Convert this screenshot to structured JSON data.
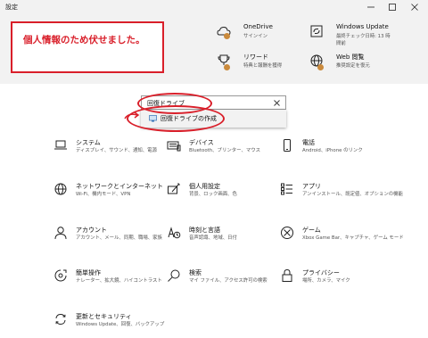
{
  "window": {
    "title": "設定"
  },
  "privacy_note": "個人情報のため伏せました。",
  "header": {
    "onedrive": {
      "title": "OneDrive",
      "subtitle": "サインイン"
    },
    "windows_update": {
      "title": "Windows Update",
      "subtitle_line1": "最終チェック日時: 13 時",
      "subtitle_line2": "間前"
    },
    "rewards": {
      "title": "リワード",
      "subtitle": "特典と報酬を獲得"
    },
    "web_browsing": {
      "title": "Web 閲覧",
      "subtitle": "推奨設定を復元"
    }
  },
  "search": {
    "value": "回復ドライブ"
  },
  "suggestion": {
    "label": "回復ドライブの作成"
  },
  "categories": [
    {
      "title": "システム",
      "subtitle": "ディスプレイ、サウンド、通知、電源",
      "icon": "laptop-icon"
    },
    {
      "title": "デバイス",
      "subtitle": "Bluetooth、プリンター、マウス",
      "icon": "keyboard-icon"
    },
    {
      "title": "電話",
      "subtitle": "Android、iPhone のリンク",
      "icon": "phone-icon"
    },
    {
      "title": "ネットワークとインターネット",
      "subtitle": "Wi-Fi、機内モード、VPN",
      "icon": "globe-icon"
    },
    {
      "title": "個人用設定",
      "subtitle": "背景、ロック画面、色",
      "icon": "pen-tablet-icon"
    },
    {
      "title": "アプリ",
      "subtitle": "アンインストール、既定値、オプションの機能",
      "icon": "apps-list-icon"
    },
    {
      "title": "アカウント",
      "subtitle": "アカウント、メール、同期、職場、家族",
      "icon": "person-icon"
    },
    {
      "title": "時刻と言語",
      "subtitle": "音声認識、地域、日付",
      "icon": "time-language-icon"
    },
    {
      "title": "ゲーム",
      "subtitle": "Xbox Game Bar、キャプチャ、ゲーム モード",
      "icon": "xbox-icon"
    },
    {
      "title": "簡単操作",
      "subtitle": "ナレーター、拡大鏡、ハイコントラスト",
      "icon": "ease-of-access-icon"
    },
    {
      "title": "検索",
      "subtitle": "マイ ファイル、アクセス許可の検索",
      "icon": "search-icon"
    },
    {
      "title": "プライバシー",
      "subtitle": "場所、カメラ、マイク",
      "icon": "lock-icon"
    },
    {
      "title": "更新とセキュリティ",
      "subtitle": "Windows Update、回復、バックアップ",
      "icon": "sync-icon"
    }
  ],
  "colors": {
    "annotation_red": "#d91f2a",
    "badge_orange": "#ca8a3c",
    "header_bg": "#f2f2f2"
  }
}
